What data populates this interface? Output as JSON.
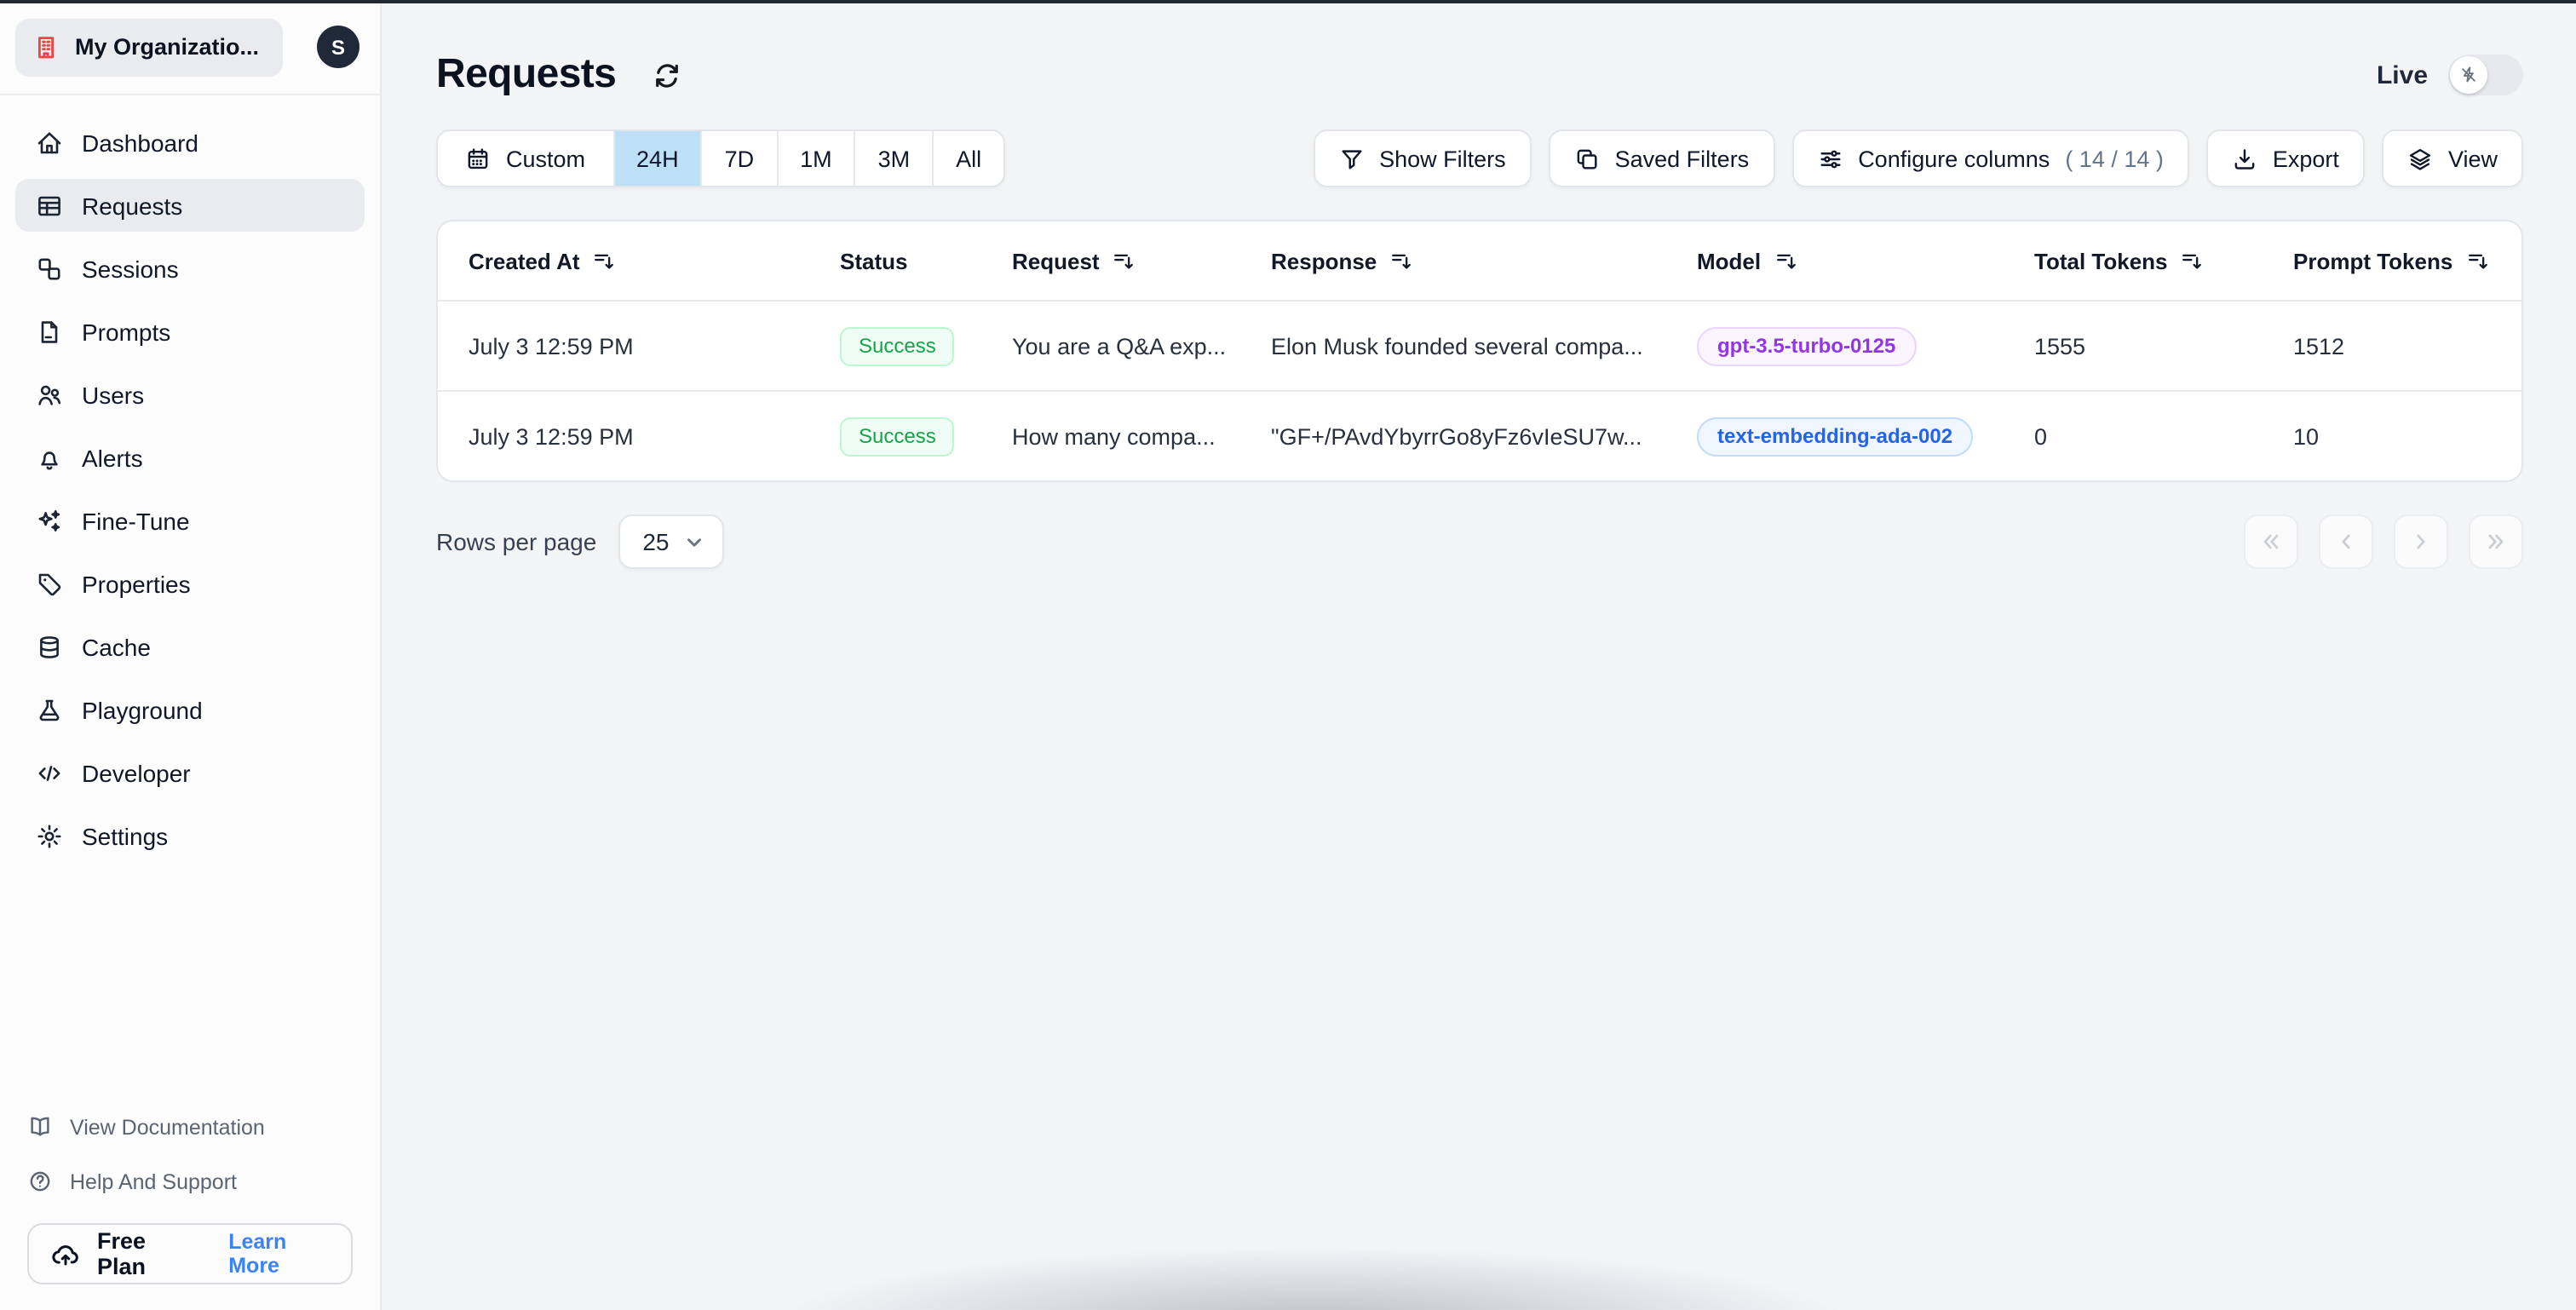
{
  "sidebar": {
    "org": {
      "name": "My Organizatio...",
      "avatar_initial": "S"
    },
    "nav": [
      {
        "label": "Dashboard"
      },
      {
        "label": "Requests",
        "active": true
      },
      {
        "label": "Sessions"
      },
      {
        "label": "Prompts"
      },
      {
        "label": "Users"
      },
      {
        "label": "Alerts"
      },
      {
        "label": "Fine-Tune"
      },
      {
        "label": "Properties"
      },
      {
        "label": "Cache"
      },
      {
        "label": "Playground"
      },
      {
        "label": "Developer"
      },
      {
        "label": "Settings"
      }
    ],
    "footer_links": [
      {
        "label": "View Documentation"
      },
      {
        "label": "Help And Support"
      }
    ],
    "plan": {
      "label": "Free Plan",
      "link": "Learn More"
    }
  },
  "header": {
    "title": "Requests",
    "live_label": "Live"
  },
  "toolbar": {
    "time_ranges": [
      {
        "label": "Custom"
      },
      {
        "label": "24H",
        "selected": true
      },
      {
        "label": "7D"
      },
      {
        "label": "1M"
      },
      {
        "label": "3M"
      },
      {
        "label": "All"
      }
    ],
    "actions": {
      "show_filters": "Show Filters",
      "saved_filters": "Saved Filters",
      "configure_columns": "Configure columns",
      "configure_columns_count": "( 14 / 14 )",
      "export": "Export",
      "view": "View"
    }
  },
  "table": {
    "columns": [
      {
        "label": "Created At",
        "sortable": true
      },
      {
        "label": "Status",
        "sortable": false
      },
      {
        "label": "Request",
        "sortable": true
      },
      {
        "label": "Response",
        "sortable": true
      },
      {
        "label": "Model",
        "sortable": true
      },
      {
        "label": "Total Tokens",
        "sortable": true
      },
      {
        "label": "Prompt Tokens",
        "sortable": true
      }
    ],
    "rows": [
      {
        "created_at": "July 3 12:59 PM",
        "status": "Success",
        "request": "You are a Q&A exp...",
        "response": "Elon Musk founded several compa...",
        "model": "gpt-3.5-turbo-0125",
        "total_tokens": "1555",
        "prompt_tokens": "1512"
      },
      {
        "created_at": "July 3 12:59 PM",
        "status": "Success",
        "request": "How many compa...",
        "response": "\"GF+/PAvdYbyrrGo8yFz6vIeSU7w...",
        "model": "text-embedding-ada-002",
        "total_tokens": "0",
        "prompt_tokens": "10"
      }
    ]
  },
  "pagination": {
    "label": "Rows per page",
    "per_page": "25"
  },
  "colors": {
    "selected_range_bg": "#bee0f6",
    "success_text": "#16a34a",
    "model_gpt_text": "#9333ea",
    "model_embedding_text": "#2563eb",
    "learn_more_link": "#3b82f6",
    "org_icon": "#ef4444",
    "avatar_bg": "#1f2937"
  }
}
